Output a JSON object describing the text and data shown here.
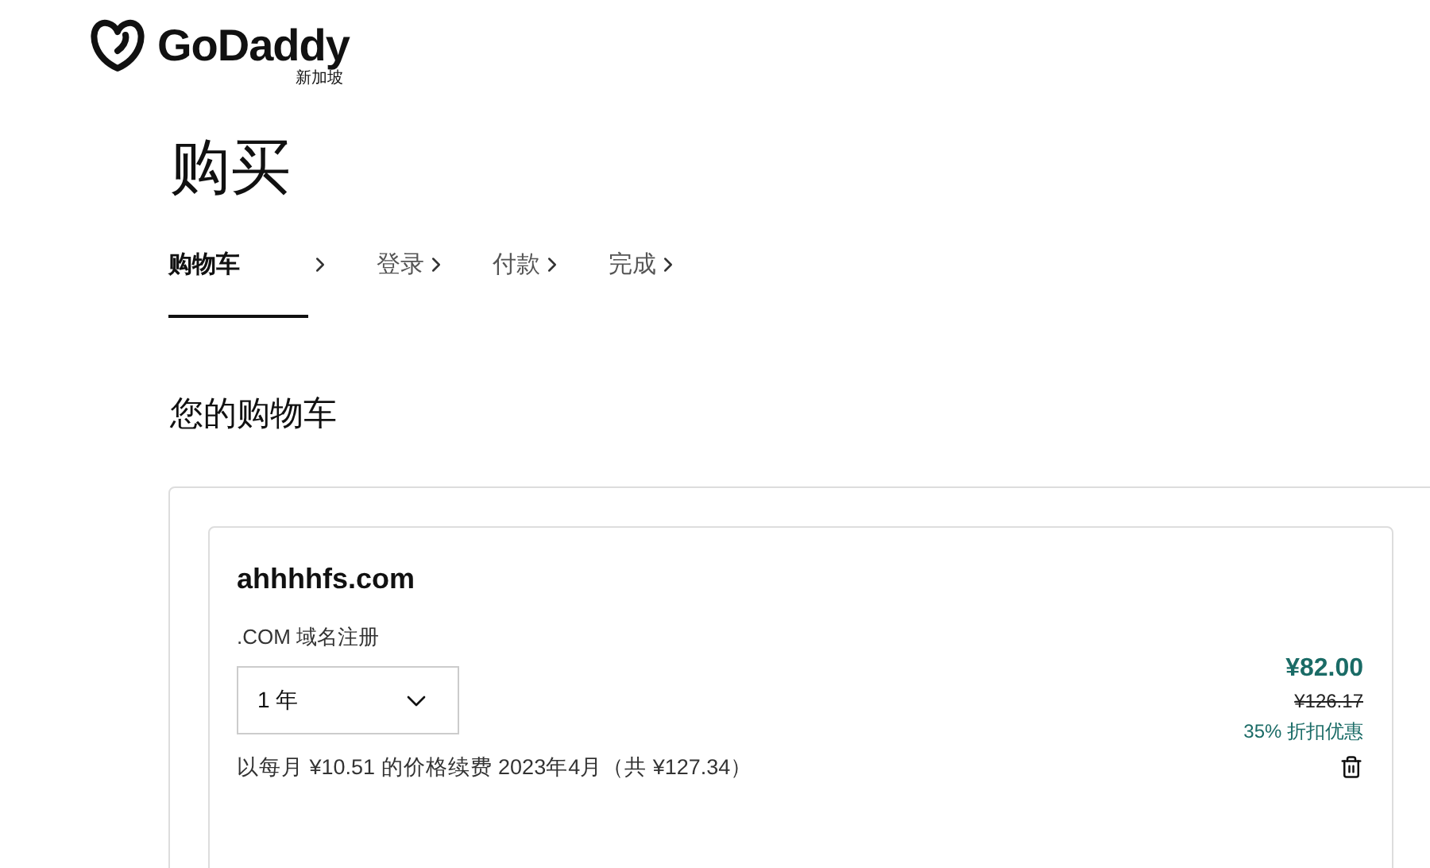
{
  "brand": {
    "name": "GoDaddy",
    "region": "新加坡"
  },
  "page_title": "购买",
  "steps": [
    {
      "label": "购物车",
      "selected": true
    },
    {
      "label": "登录",
      "selected": false
    },
    {
      "label": "付款",
      "selected": false
    },
    {
      "label": "完成",
      "selected": false
    }
  ],
  "cart": {
    "title": "您的购物车",
    "items": [
      {
        "domain": "ahhhhfs.com",
        "product": ".COM 域名注册",
        "term": "1 年",
        "renewal": "以每月 ¥10.51 的价格续费 2023年4月（共 ¥127.34）",
        "price": "¥82.00",
        "original_price": "¥126.17",
        "discount": "35% 折扣优惠"
      }
    ]
  }
}
